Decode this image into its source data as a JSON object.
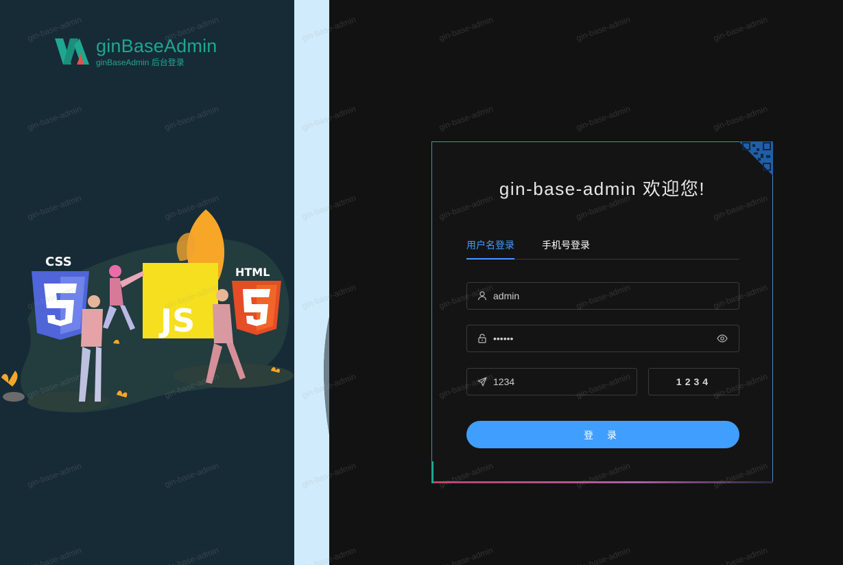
{
  "brand": {
    "name": "ginBaseAdmin",
    "subtitle": "ginBaseAdmin 后台登录",
    "color": "#1fa78f"
  },
  "illustration": {
    "labels": [
      "CSS",
      "JS",
      "HTML"
    ]
  },
  "login": {
    "title": "gin-base-admin 欢迎您!",
    "tabs": [
      {
        "label": "用户名登录",
        "active": true
      },
      {
        "label": "手机号登录",
        "active": false
      }
    ],
    "username": {
      "value": "admin",
      "icon": "user-icon"
    },
    "password": {
      "value": "••••••",
      "icon": "lock-icon",
      "toggle_icon": "eye-icon"
    },
    "captcha_input": {
      "value": "1234",
      "icon": "send-icon"
    },
    "captcha_image_text": "1234",
    "submit_label": "登 录",
    "accent_color": "#409eff"
  },
  "watermark": {
    "text": "gin-base-admin"
  }
}
